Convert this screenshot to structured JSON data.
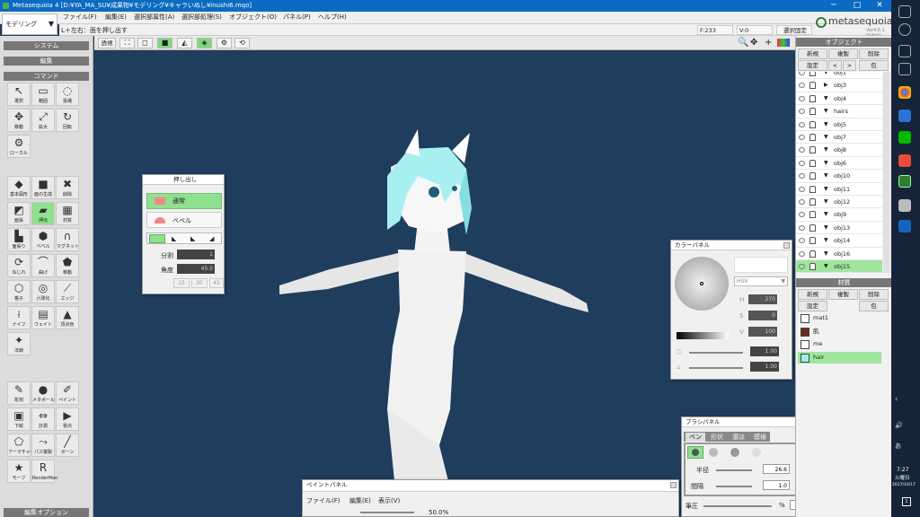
{
  "window": {
    "title": "Metasequoia 4 [D:¥YA_MA_SU¥成果物¥モデリング¥キャラいぬし¥inushi6.mqo]",
    "minimize": "─",
    "maximize": "□",
    "close": "✕"
  },
  "mode": {
    "value": "モデリング"
  },
  "menu": [
    "ファイル(F)",
    "編集(E)",
    "選択部属性(A)",
    "選択部処理(S)",
    "オブジェクト(O)",
    "パネル(P)",
    "ヘルプ(H)"
  ],
  "status": {
    "hint": "L＋左右：面を押し出す",
    "faces": "F:233",
    "verts": "V:0",
    "selfix": "選択固定"
  },
  "logo": {
    "name": "metasequoia4",
    "version": "Ver4.6.1 (64bit)"
  },
  "left": {
    "system": "システム",
    "edit": "編集",
    "command": "コマンド",
    "editopt": "編集オプション",
    "tools1": [
      {
        "label": "選択",
        "icon": "cursor-icon",
        "g": "↖"
      },
      {
        "label": "範囲",
        "icon": "rect-select-icon",
        "g": "▭"
      },
      {
        "label": "投縄",
        "icon": "lasso-icon",
        "g": "◌"
      },
      {
        "label": "移動",
        "icon": "move-icon",
        "g": "✥"
      },
      {
        "label": "拡大",
        "icon": "scale-icon",
        "g": "⤢"
      },
      {
        "label": "回転",
        "icon": "rotate-icon",
        "g": "↻"
      },
      {
        "label": "ローカル",
        "icon": "local-icon",
        "g": "⚙"
      }
    ],
    "tools2": [
      {
        "label": "基本図形",
        "icon": "primitive-icon",
        "g": "◆"
      },
      {
        "label": "面の生成",
        "icon": "face-create-icon",
        "g": "■"
      },
      {
        "label": "削除",
        "icon": "delete-icon",
        "g": "✖"
      },
      {
        "label": "面張",
        "icon": "face-paste-icon",
        "g": "◩"
      },
      {
        "label": "押出",
        "icon": "extrude-icon",
        "g": "▰"
      },
      {
        "label": "材質",
        "icon": "material-icon",
        "g": "▦"
      },
      {
        "label": "面張り",
        "icon": "face-fill-icon",
        "g": "▙"
      },
      {
        "label": "ベベル",
        "icon": "bevel-icon",
        "g": "⬢"
      },
      {
        "label": "マグネット",
        "icon": "magnet-icon",
        "g": "∩"
      },
      {
        "label": "ねじれ",
        "icon": "twist-icon",
        "g": "⟳"
      },
      {
        "label": "曲げ",
        "icon": "bend-icon",
        "g": "⌒"
      },
      {
        "label": "移動",
        "icon": "warp-icon",
        "g": "⬟"
      },
      {
        "label": "格子",
        "icon": "lattice-icon",
        "g": "⬡"
      },
      {
        "label": "六球化",
        "icon": "sphere-icon",
        "g": "◎"
      },
      {
        "label": "エッジ",
        "icon": "edge-icon",
        "g": "⟋"
      },
      {
        "label": "ナイフ",
        "icon": "knife-icon",
        "g": "⟊"
      },
      {
        "label": "ウェイト",
        "icon": "weight-icon",
        "g": "▤"
      },
      {
        "label": "頂点色",
        "icon": "vertex-color-icon",
        "g": "▲"
      },
      {
        "label": "法線",
        "icon": "normal-icon",
        "g": "✦"
      }
    ],
    "tools3": [
      {
        "label": "彫刻",
        "icon": "sculpt-icon",
        "g": "✎"
      },
      {
        "label": "メタボール",
        "icon": "metaball-icon",
        "g": "●"
      },
      {
        "label": "ペイント",
        "icon": "paint-icon",
        "g": "✐"
      },
      {
        "label": "下絵",
        "icon": "underlay-icon",
        "g": "▣"
      },
      {
        "label": "計測",
        "icon": "measure-icon",
        "g": "⇔"
      },
      {
        "label": "視点",
        "icon": "camera-icon",
        "g": "▶"
      },
      {
        "label": "アーマチャー",
        "icon": "armature-icon",
        "g": "⬠"
      },
      {
        "label": "パス複製",
        "icon": "path-dup-icon",
        "g": "⤳"
      },
      {
        "label": "ボーン",
        "icon": "bone-icon",
        "g": "╱"
      },
      {
        "label": "モーフ",
        "icon": "morph-icon",
        "g": "★"
      },
      {
        "label": "RenderMan",
        "icon": "renderman-icon",
        "g": "R"
      }
    ]
  },
  "viewtool": {
    "persp": "透視",
    "buttons": [
      "⛶",
      "◻",
      "■",
      "◭",
      "◈",
      "⚙",
      "⟲"
    ]
  },
  "extrude": {
    "title": "押し出し",
    "normal": "通常",
    "bevel": "ベベル",
    "split_label": "分割",
    "split": "1",
    "angle_label": "角度",
    "angle": "45.0",
    "p1": "15",
    "p2": "30",
    "p3": "45"
  },
  "color": {
    "title": "カラーパネル",
    "mode": "HSV",
    "h_label": "H",
    "h": "270",
    "s_label": "S",
    "s": "0",
    "v_label": "V",
    "v": "100",
    "a": "1.00",
    "b": "1.00"
  },
  "brush": {
    "title": "ブラシパネル",
    "tabs": [
      "ペン",
      "形状",
      "濃淡",
      "模様"
    ],
    "radius_label": "半径",
    "radius": "26.6",
    "radius_unit": "pixel",
    "spacing_label": "間隔",
    "spacing": "1.0",
    "spacing_unit": "pixel",
    "pressure_label": "筆圧",
    "pressure_unit": "%",
    "pressure": "100"
  },
  "paint": {
    "title": "ペイントパネル",
    "menu": [
      "ファイル(F)",
      "編集(E)",
      "表示(V)"
    ],
    "zoom": "50.0%"
  },
  "objects": {
    "title": "オブジェクト",
    "new": "新規",
    "dup": "複製",
    "del": "削除",
    "set": "設定",
    "prev": "<",
    "next": ">",
    "wrap": "包",
    "items": [
      "obj1",
      "obj3",
      "obj4",
      "hairs",
      "obj5",
      "obj7",
      "obj8",
      "obj6",
      "obj10",
      "obj11",
      "obj12",
      "obj9",
      "obj13",
      "obj14",
      "obj16",
      "obj15"
    ]
  },
  "materials": {
    "title": "材質",
    "new": "新規",
    "dup": "複製",
    "del": "削除",
    "set": "設定",
    "wrap": "包",
    "items": [
      {
        "name": "mat1",
        "color": "#ffffff"
      },
      {
        "name": "肌",
        "color": "#6b2b1a"
      },
      {
        "name": "me",
        "color": "#ffffff"
      },
      {
        "name": "hair",
        "color": "#9cf0f0"
      }
    ]
  },
  "taskbar": {
    "time": "7:27",
    "weekday": "火曜日",
    "date": "2017/10/17",
    "lang": "あ",
    "notif": "1"
  }
}
